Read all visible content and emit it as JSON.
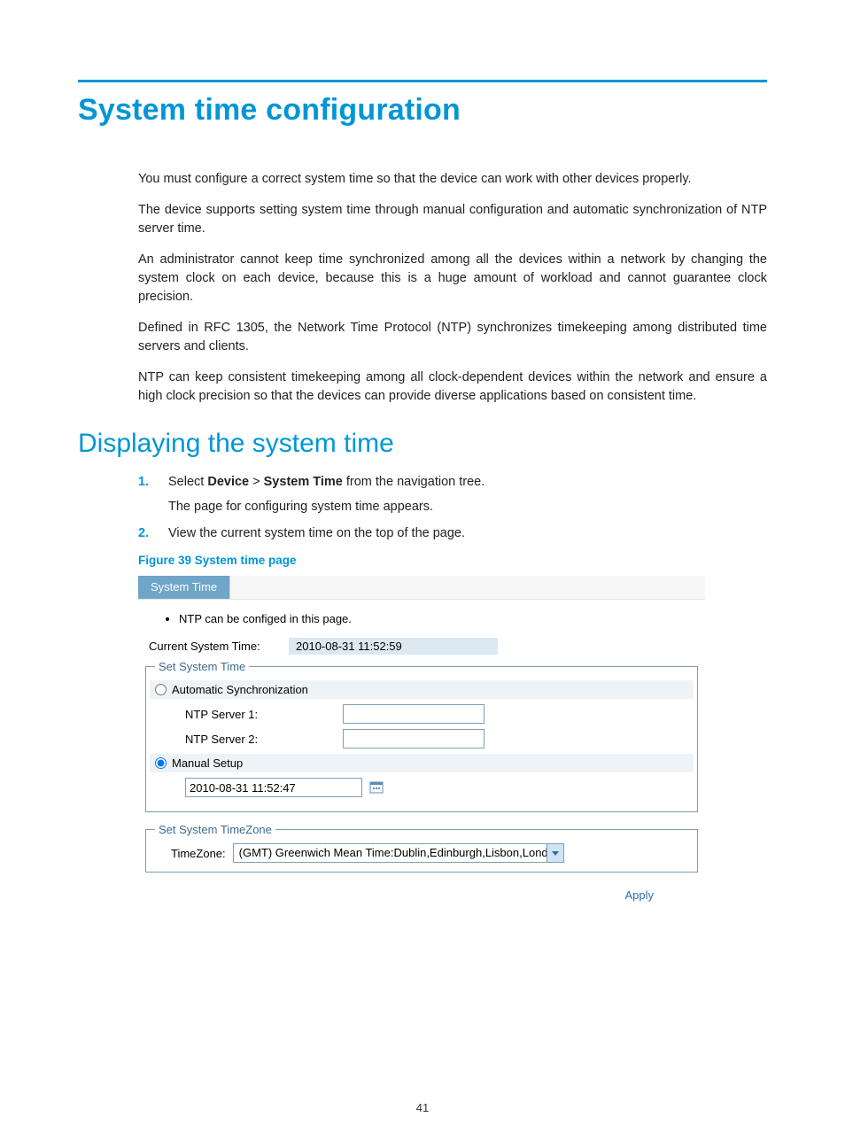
{
  "page": {
    "title": "System time configuration",
    "p1": "You must configure a correct system time so that the device can work with other devices properly.",
    "p2": "The device supports setting system time through manual configuration and automatic synchronization of NTP server time.",
    "p3": "An administrator cannot keep time synchronized among all the devices within a network by changing the system clock on each device, because this is a huge amount of workload and cannot guarantee clock precision.",
    "p4": "Defined in RFC 1305, the Network Time Protocol (NTP) synchronizes timekeeping among distributed time servers and clients.",
    "p5": "NTP can keep consistent timekeeping among all clock-dependent devices within the network and ensure a high clock precision so that the devices can provide diverse applications based on consistent time.",
    "section2": "Displaying the system time",
    "step1": {
      "pre": "Select ",
      "b1": "Device",
      "gt": " > ",
      "b2": "System Time",
      "post": " from the navigation tree."
    },
    "step1_sub": "The page for configuring system time appears.",
    "step2": "View the current system time on the top of the page.",
    "figure": "Figure 39 System time page",
    "page_number": "41"
  },
  "ui": {
    "tab": "System Time",
    "note": "NTP can be configed in this page.",
    "cur_label": "Current System Time:",
    "cur_value": "2010-08-31 11:52:59",
    "fs1_legend": "Set System Time",
    "auto_label": "Automatic Synchronization",
    "ntp1_label": "NTP Server 1:",
    "ntp2_label": "NTP Server 2:",
    "ntp1_value": "",
    "ntp2_value": "",
    "manual_label": "Manual Setup",
    "manual_value": "2010-08-31 11:52:47",
    "mode_selected": "manual",
    "fs2_legend": "Set System TimeZone",
    "tz_label": "TimeZone:",
    "tz_value": "(GMT) Greenwich Mean Time:Dublin,Edinburgh,Lisbon,London",
    "apply": "Apply"
  }
}
